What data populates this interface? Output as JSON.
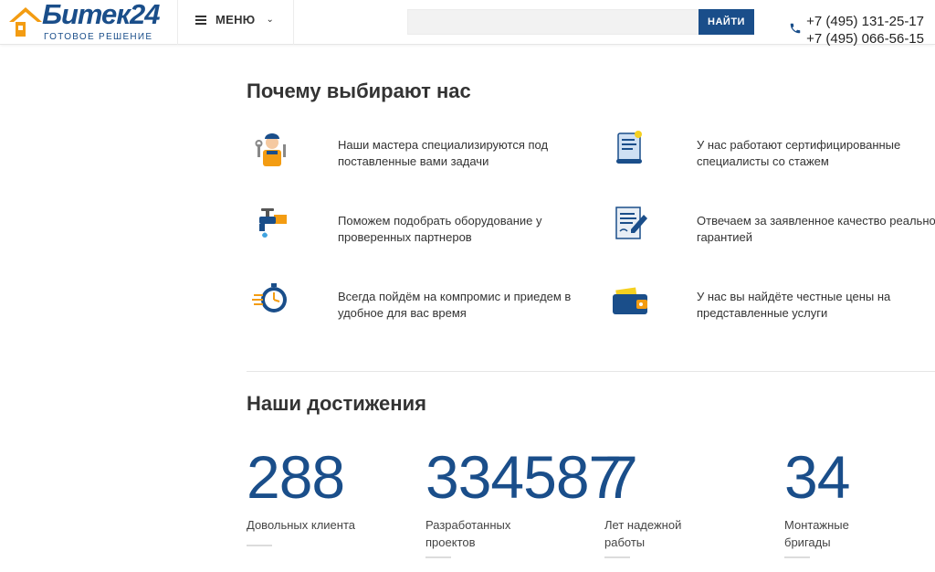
{
  "header": {
    "logo_text": "Битек24",
    "logo_subtitle": "ГОТОВОЕ РЕШЕНИЕ",
    "menu_label": "МЕНЮ",
    "search_placeholder": "",
    "search_button": "НАЙТИ",
    "phones": [
      "+7 (495) 131-25-17",
      "+7 (495) 066-56-15"
    ]
  },
  "why": {
    "title": "Почему выбирают нас",
    "items": [
      {
        "icon": "plumber-icon",
        "text": "Наши мастера специализируются под поставленные вами задачи"
      },
      {
        "icon": "certificate-scroll-icon",
        "text": "У нас работают сертифицированные специалисты со стажем"
      },
      {
        "icon": "faucet-icon",
        "text": "Поможем подобрать оборудование у проверенных партнеров"
      },
      {
        "icon": "document-pen-icon",
        "text": "Отвечаем за заявленное качество реальной гарантией"
      },
      {
        "icon": "stopwatch-icon",
        "text": "Всегда пойдём на компромис и приедем в удобное для вас время"
      },
      {
        "icon": "wallet-icon",
        "text": "У нас вы найдёте честные цены на представленные услуги"
      }
    ]
  },
  "achievements": {
    "title": "Наши достижения",
    "stats": [
      {
        "value": "288",
        "label": "Довольных клиента"
      },
      {
        "value": "334587",
        "label": "Разработанных проектов"
      },
      {
        "value": "7",
        "label": "Лет надежной работы"
      },
      {
        "value": "34",
        "label": "Монтажные бригады"
      }
    ]
  },
  "colors": {
    "brand": "#1a4e8a",
    "accent": "#f39c12"
  }
}
